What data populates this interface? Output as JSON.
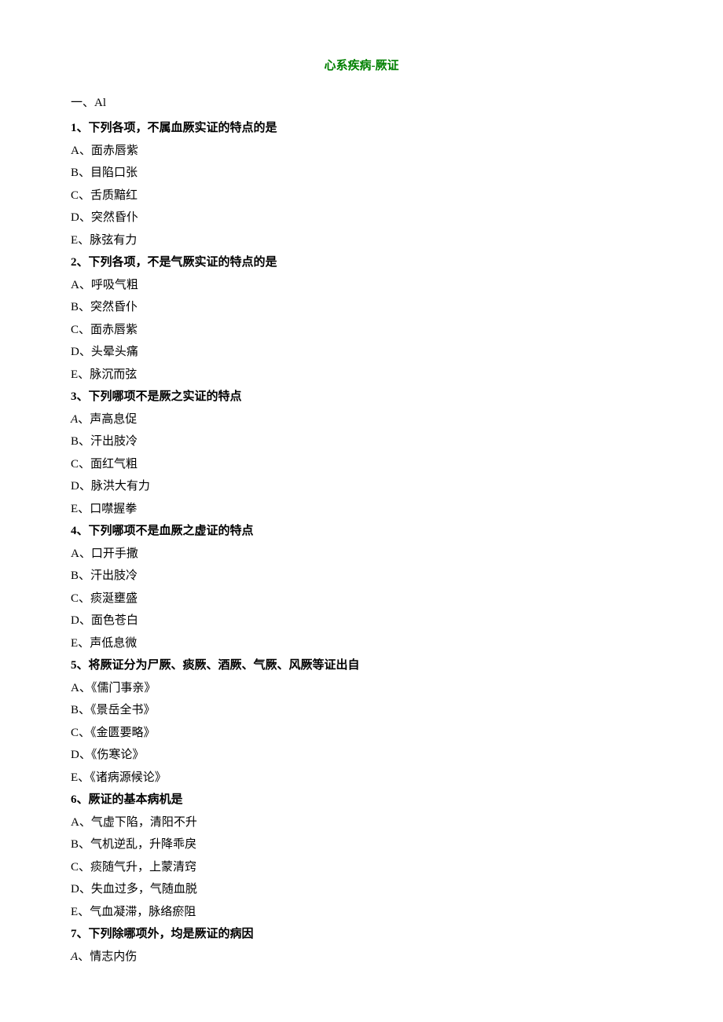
{
  "title": "心系疾病-厥证",
  "section_label": "一、Al",
  "questions": [
    {
      "stem": "1、下列各项，不属血厥实证的特点的是",
      "options": [
        {
          "letter": "A",
          "text": "面赤唇紫",
          "italic": false
        },
        {
          "letter": "B",
          "text": "目陷口张",
          "italic": false
        },
        {
          "letter": "C",
          "text": "舌质黯红",
          "italic": false
        },
        {
          "letter": "D",
          "text": "突然昏仆",
          "italic": false
        },
        {
          "letter": "E",
          "text": "脉弦有力",
          "italic": false
        }
      ]
    },
    {
      "stem": "2、下列各项，不是气厥实证的特点的是",
      "options": [
        {
          "letter": "A",
          "text": "呼吸气粗",
          "italic": false
        },
        {
          "letter": "B",
          "text": "突然昏仆",
          "italic": false
        },
        {
          "letter": "C",
          "text": "面赤唇紫",
          "italic": false
        },
        {
          "letter": "D",
          "text": "头晕头痛",
          "italic": false
        },
        {
          "letter": "E",
          "text": "脉沉而弦",
          "italic": false
        }
      ]
    },
    {
      "stem": "3、下列哪项不是厥之实证的特点",
      "options": [
        {
          "letter": "A",
          "text": "声高息促",
          "italic": true
        },
        {
          "letter": "B",
          "text": "汗出肢冷",
          "italic": false
        },
        {
          "letter": "C",
          "text": "面红气粗",
          "italic": false
        },
        {
          "letter": "D",
          "text": "脉洪大有力",
          "italic": false
        },
        {
          "letter": "E",
          "text": "口噤握拳",
          "italic": false
        }
      ]
    },
    {
      "stem": "4、下列哪项不是血厥之虚证的特点",
      "options": [
        {
          "letter": "A",
          "text": "口开手撒",
          "italic": false
        },
        {
          "letter": "B",
          "text": "汗出肢冷",
          "italic": false
        },
        {
          "letter": "C",
          "text": "痰涎壅盛",
          "italic": false
        },
        {
          "letter": "D",
          "text": "面色苍白",
          "italic": false
        },
        {
          "letter": "E",
          "text": "声低息微",
          "italic": false
        }
      ]
    },
    {
      "stem": "5、将厥证分为尸厥、痰厥、酒厥、气厥、风厥等证出自",
      "options": [
        {
          "letter": "A",
          "text": "《儒门事亲》",
          "italic": false
        },
        {
          "letter": "B",
          "text": "《景岳全书》",
          "italic": false
        },
        {
          "letter": "C",
          "text": "《金匮要略》",
          "italic": false
        },
        {
          "letter": "D",
          "text": "《伤寒论》",
          "italic": false
        },
        {
          "letter": "E",
          "text": "《诸病源候论》",
          "italic": false
        }
      ]
    },
    {
      "stem": "6、厥证的基本病机是",
      "options": [
        {
          "letter": "A",
          "text": "气虚下陷，清阳不升",
          "italic": false
        },
        {
          "letter": "B",
          "text": "气机逆乱，升降乖戾",
          "italic": false
        },
        {
          "letter": "C",
          "text": "痰随气升，上蒙清窍",
          "italic": false
        },
        {
          "letter": "D",
          "text": "失血过多，气随血脱",
          "italic": false
        },
        {
          "letter": "E",
          "text": "气血凝滞，脉络瘀阻",
          "italic": false
        }
      ]
    },
    {
      "stem": "7、下列除哪项外，均是厥证的病因",
      "options": [
        {
          "letter": "A",
          "text": "情志内伤",
          "italic": true
        }
      ]
    }
  ]
}
